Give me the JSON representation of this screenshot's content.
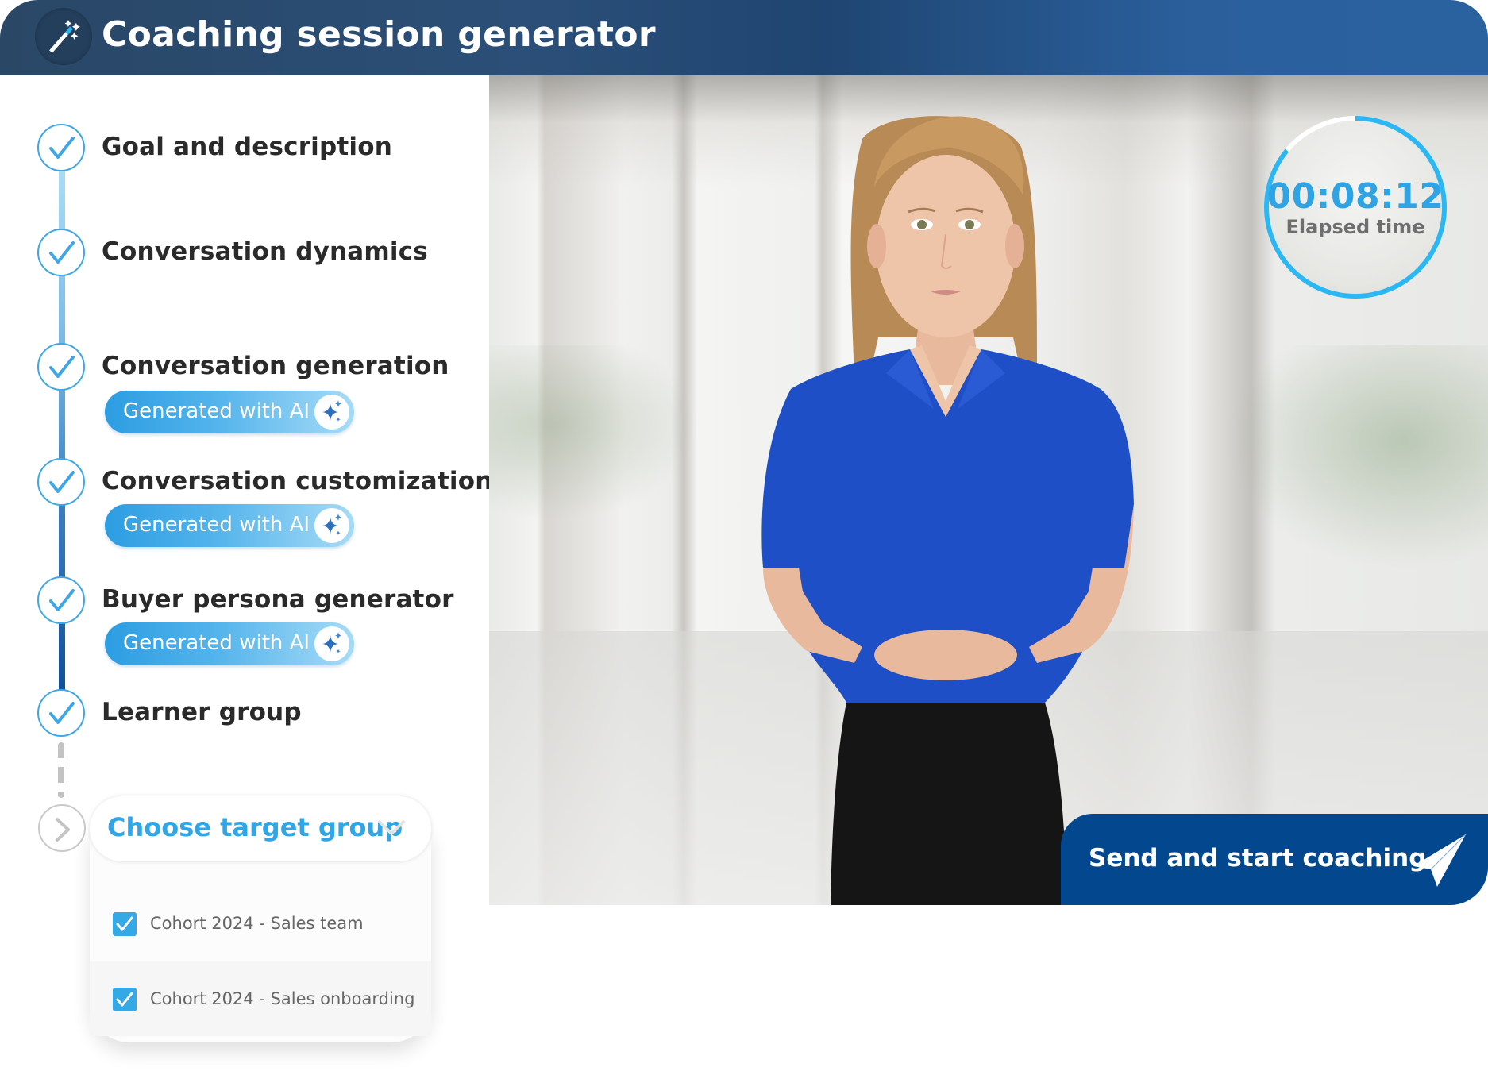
{
  "header": {
    "title": "Coaching session generator",
    "icon": "magic-wand-icon"
  },
  "steps": [
    {
      "title": "Goal and description",
      "status": "completed",
      "badge": null
    },
    {
      "title": "Conversation dynamics",
      "status": "completed",
      "badge": null
    },
    {
      "title": "Conversation generation",
      "status": "completed",
      "badge": "Generated with AI"
    },
    {
      "title": "Conversation customization",
      "status": "completed",
      "badge": "Generated with AI"
    },
    {
      "title": "Buyer persona generator",
      "status": "completed",
      "badge": "Generated with AI"
    },
    {
      "title": "Learner group",
      "status": "completed",
      "badge": null
    }
  ],
  "target_group": {
    "placeholder": "Choose target group",
    "options": [
      {
        "label": "Cohort 2024 - Sales team",
        "checked": true
      },
      {
        "label": "Cohort 2024 - Sales onboarding",
        "checked": true
      }
    ]
  },
  "timer": {
    "value": "00:08:12",
    "label": "Elapsed time",
    "progress": 0.86
  },
  "send_button": {
    "label": "Send and start coaching",
    "icon": "paper-plane-icon"
  },
  "colors": {
    "header_dark": "#2a4766",
    "header_light": "#2a62a0",
    "accent": "#30a6e6",
    "send_button": "#03478f",
    "step_text": "#2a2a2a"
  }
}
